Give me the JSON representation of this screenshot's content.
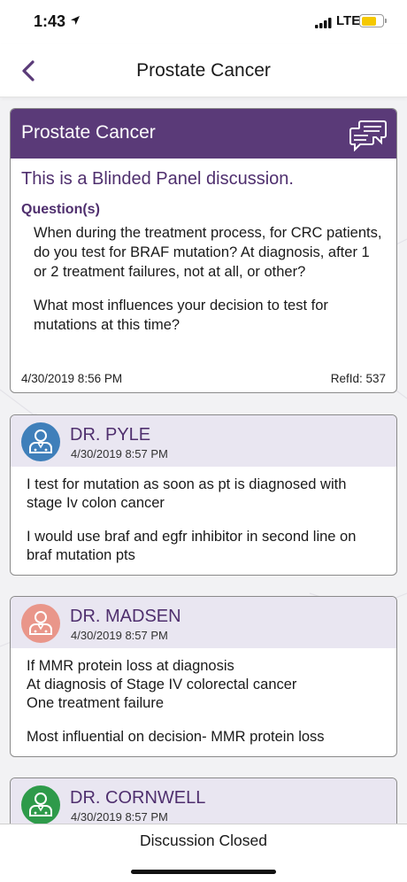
{
  "status_bar": {
    "time": "1:43",
    "network": "LTE"
  },
  "nav": {
    "title": "Prostate Cancer"
  },
  "topic": {
    "header_title": "Prostate Cancer",
    "blinded_text": "This is a Blinded Panel discussion.",
    "questions_label": "Question(s)",
    "questions": [
      "When during the treatment process, for CRC patients, do you test for BRAF mutation? At diagnosis, after 1 or 2 treatment failures, not at all, or other?",
      "What most influences your decision to test for mutations at this time?"
    ],
    "timestamp": "4/30/2019 8:56 PM",
    "ref_id": "RefId: 537"
  },
  "responses": [
    {
      "doctor": "DR. PYLE",
      "timestamp": "4/30/2019 8:57 PM",
      "avatar_color": "#3f7fba",
      "paragraphs": [
        "I test for mutation as soon as pt is diagnosed with stage Iv colon cancer",
        "I would use braf and egfr inhibitor in second line on braf mutation pts"
      ]
    },
    {
      "doctor": "DR. MADSEN",
      "timestamp": "4/30/2019 8:57 PM",
      "avatar_color": "#e9968a",
      "paragraphs": [
        "If MMR protein loss at diagnosis\nAt diagnosis of Stage IV colorectal cancer\nOne treatment failure",
        "Most influential on decision- MMR protein loss"
      ]
    },
    {
      "doctor": "DR. CORNWELL",
      "timestamp": "4/30/2019 8:57 PM",
      "avatar_color": "#2e9a4a",
      "paragraphs": []
    }
  ],
  "bottom": {
    "label": "Discussion Closed"
  },
  "colors": {
    "accent": "#5a3a78",
    "header_tint": "#e9e6f1"
  },
  "icons": [
    "location-arrow-icon",
    "signal-icon",
    "battery-icon",
    "back-chevron-icon",
    "chat-bubbles-icon",
    "doctor-avatar-icon"
  ]
}
